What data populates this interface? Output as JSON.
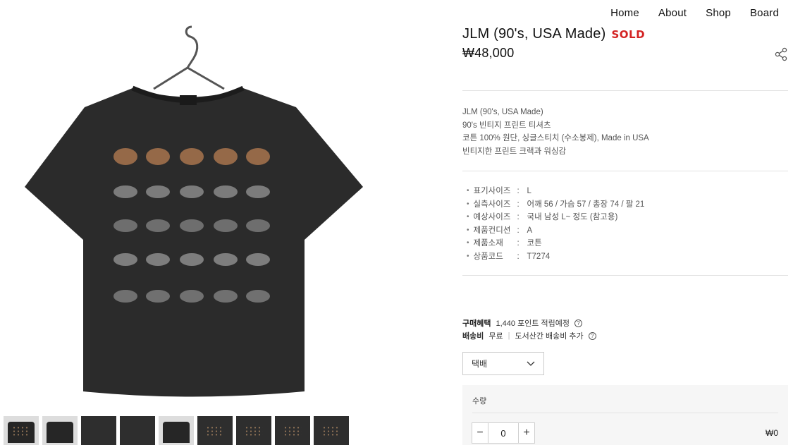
{
  "nav": {
    "items": [
      "Home",
      "About",
      "Shop",
      "Board"
    ]
  },
  "product": {
    "title": "JLM (90's, USA Made)",
    "sold_badge": "SOLD",
    "price": "₩48,000",
    "description": [
      "JLM (90's, USA Made)",
      "90's 빈티지 프린트 티셔츠",
      "코튼 100% 원단, 싱글스티치 (수소봉제), Made in USA",
      "빈티지한 프린트 크랙과 워싱감"
    ],
    "specs": [
      {
        "key": "표기사이즈",
        "value": "L"
      },
      {
        "key": "실측사이즈",
        "value": "어깨 56 / 가슴 57 / 총장 74 / 팔 21"
      },
      {
        "key": "예상사이즈",
        "value": "국내 남성 L~ 정도 (참고용)"
      },
      {
        "key": "제품컨디션",
        "value": "A"
      },
      {
        "key": "제품소재",
        "value": "코튼"
      },
      {
        "key": "상품코드",
        "value": "T7274"
      }
    ],
    "spec_separator": ":"
  },
  "purchase": {
    "benefit_label": "구매혜택",
    "benefit_value": "1,440 포인트 적립예정",
    "shipping_label": "배송비",
    "shipping_value": "무료",
    "shipping_note": "도서산간 배송비 추가",
    "shipping_option": "택배",
    "qty_label": "수량",
    "qty_value": "0",
    "total": "₩0"
  },
  "colors": {
    "sold": "#d32222",
    "shirt": "#2b2b2b"
  },
  "icons": {
    "share": "share-icon",
    "help": "question-circle-icon",
    "dropdown": "chevron-down-icon"
  }
}
